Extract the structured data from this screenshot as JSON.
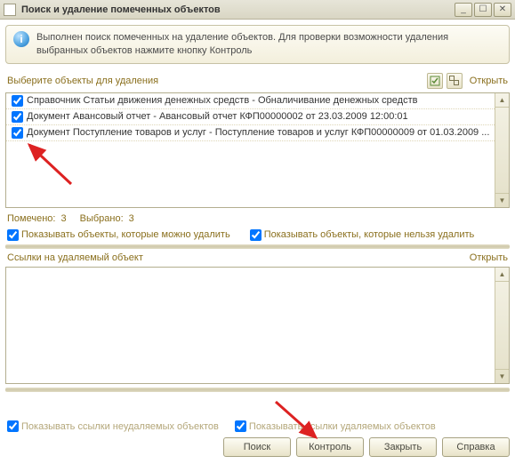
{
  "window": {
    "title": "Поиск и удаление помеченных объектов"
  },
  "banner": {
    "text": "Выполнен поиск помеченных на удаление объектов. Для проверки возможности удаления выбранных объектов нажмите кнопку Контроль"
  },
  "selection": {
    "label": "Выберите объекты для удаления",
    "open": "Открыть",
    "items": [
      "Справочник Статьи движения денежных средств - Обналичивание денежных средств",
      "Документ Авансовый отчет - Авансовый отчет КФП00000002 от 23.03.2009 12:00:01",
      "Документ Поступление товаров и услуг - Поступление товаров и услуг КФП00000009 от 01.03.2009 ..."
    ]
  },
  "status": {
    "marked_label": "Помечено:",
    "marked_count": "3",
    "selected_label": "Выбрано:",
    "selected_count": "3",
    "show_deletable": "Показывать объекты, которые можно удалить",
    "show_not_deletable": "Показывать объекты, которые нельзя удалить"
  },
  "refs": {
    "label": "Ссылки на удаляемый объект",
    "open": "Открыть"
  },
  "footer_opts": {
    "show_nondel_links": "Показывать ссылки неудаляемых объектов",
    "show_del_links": "Показывать ссылки удаляемых объектов"
  },
  "buttons": {
    "search": "Поиск",
    "control": "Контроль",
    "close": "Закрыть",
    "help": "Справка"
  }
}
